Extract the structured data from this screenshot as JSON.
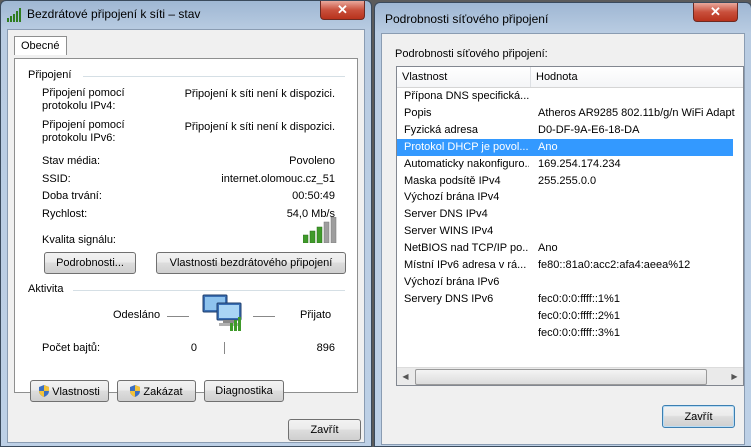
{
  "left_window": {
    "title": "Bezdrátové připojení k síti – stav",
    "close_glyph": "✕",
    "tab": "Obecné",
    "connection_group": "Připojení",
    "rows": [
      {
        "label": "Připojení pomocí\nprotokolu IPv4:",
        "value": "Připojení k síti není k dispozici."
      },
      {
        "label": "Připojení pomocí\nprotokolu IPv6:",
        "value": "Připojení k síti není k dispozici."
      },
      {
        "label": "Stav média:",
        "value": "Povoleno"
      },
      {
        "label": "SSID:",
        "value": "internet.olomouc.cz_51"
      },
      {
        "label": "Doba trvání:",
        "value": "00:50:49"
      },
      {
        "label": "Rychlost:",
        "value": "54,0 Mb/s"
      }
    ],
    "signal_label": "Kvalita signálu:",
    "signal_bars": 5,
    "details_button": "Podrobnosti...",
    "wireless_props_button": "Vlastnosti bezdrátového připojení",
    "activity_group": "Aktivita",
    "sent_label": "Odesláno",
    "received_label": "Přijato",
    "bytes_label": "Počet bajtů:",
    "bytes_sent": "0",
    "bytes_received": "896",
    "properties_button": "Vlastnosti",
    "disable_button": "Zakázat",
    "diagnose_button": "Diagnostika",
    "close_button": "Zavřít"
  },
  "right_window": {
    "title": "Podrobnosti síťového připojení",
    "close_glyph": "✕",
    "caption": "Podrobnosti síťového připojení:",
    "col_property": "Vlastnost",
    "col_value": "Hodnota",
    "rows": [
      {
        "prop": "Přípona DNS specifická...",
        "val": ""
      },
      {
        "prop": "Popis",
        "val": "Atheros AR9285 802.11b/g/n WiFi Adapt"
      },
      {
        "prop": "Fyzická adresa",
        "val": "D0-DF-9A-E6-18-DA"
      },
      {
        "prop": "Protokol DHCP je povol...",
        "val": "Ano",
        "selected": true
      },
      {
        "prop": "Automaticky nakonfiguro...",
        "val": "169.254.174.234"
      },
      {
        "prop": "Maska podsítě IPv4",
        "val": "255.255.0.0"
      },
      {
        "prop": "Výchozí brána IPv4",
        "val": ""
      },
      {
        "prop": "Server DNS IPv4",
        "val": ""
      },
      {
        "prop": "Server WINS IPv4",
        "val": ""
      },
      {
        "prop": "NetBIOS nad TCP/IP po...",
        "val": "Ano"
      },
      {
        "prop": "Místní IPv6 adresa v rá...",
        "val": "fe80::81a0:acc2:afa4:aeea%12"
      },
      {
        "prop": "Výchozí brána IPv6",
        "val": ""
      },
      {
        "prop": "Servery DNS IPv6",
        "val": "fec0:0:0:ffff::1%1"
      },
      {
        "prop": "",
        "val": "fec0:0:0:ffff::2%1"
      },
      {
        "prop": "",
        "val": "fec0:0:0:ffff::3%1"
      }
    ],
    "close_button": "Zavřít"
  }
}
